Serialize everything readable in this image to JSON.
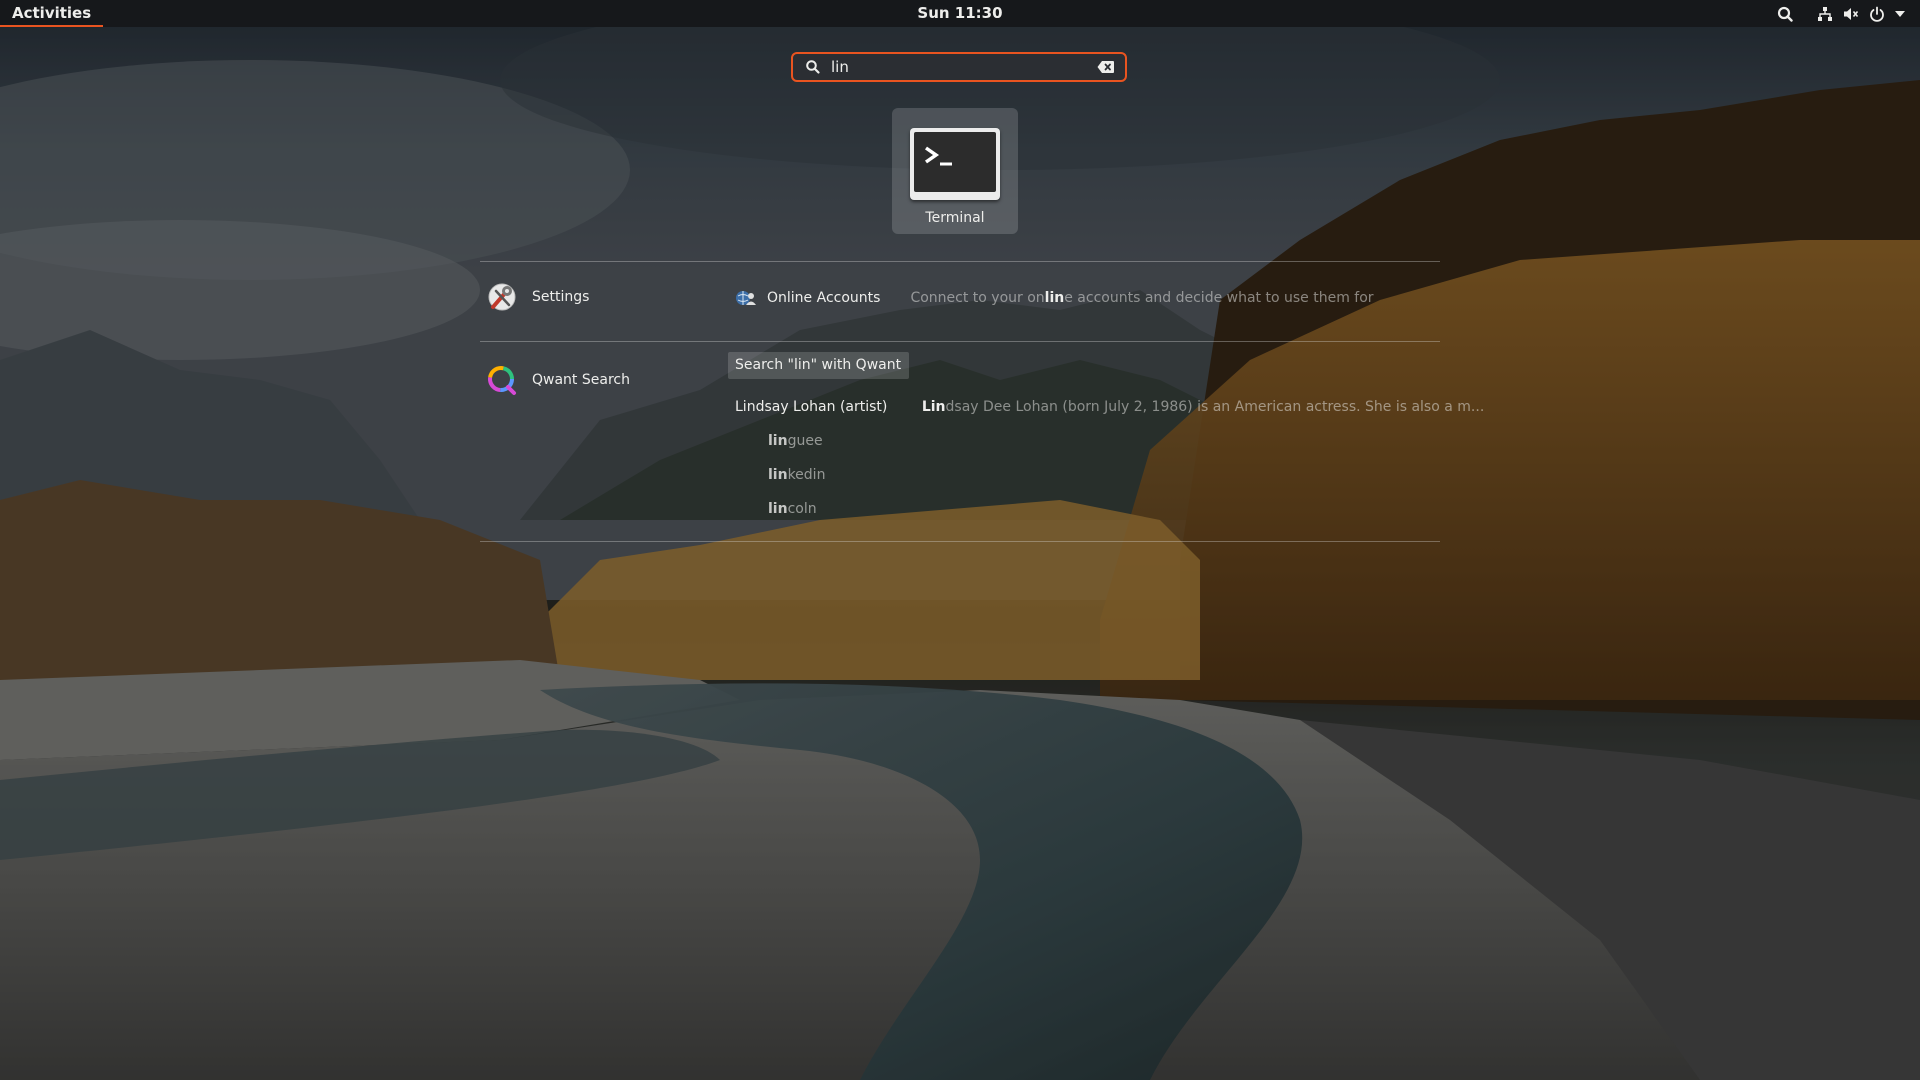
{
  "topbar": {
    "activities_label": "Activities",
    "clock": "Sun 11:30",
    "tray_icons": [
      "search-icon",
      "network-icon",
      "volume-muted-icon",
      "power-icon",
      "chevron-down-icon"
    ]
  },
  "search": {
    "value": "lin",
    "icon": "search-icon",
    "clear_icon": "clear-icon"
  },
  "apps": [
    {
      "name": "Terminal",
      "icon": "terminal-icon"
    }
  ],
  "providers": {
    "settings": {
      "name": "Settings",
      "icon": "settings-icon",
      "result": {
        "title": "Online Accounts",
        "desc_prefix": "Connect to your on",
        "desc_match": "lin",
        "desc_suffix": "e accounts and decide what to use them for",
        "icon": "online-accounts-icon"
      }
    },
    "qwant": {
      "name": "Qwant Search",
      "icon": "qwant-icon",
      "search_action": "Search \"lin\" with Qwant",
      "top_result": {
        "title": "Lindsay Lohan (artist)",
        "desc_match": "Lin",
        "desc_rest": "dsay Dee Lohan (born July 2, 1986) is an American actress. She is also a m..."
      },
      "suggestions": [
        {
          "match": "lin",
          "rest": "guee"
        },
        {
          "match": "lin",
          "rest": "kedin"
        },
        {
          "match": "lin",
          "rest": "coln"
        }
      ]
    }
  },
  "colors": {
    "accent": "#e95420",
    "topbar_bg": "#16181b",
    "text": "#eeeeec"
  }
}
